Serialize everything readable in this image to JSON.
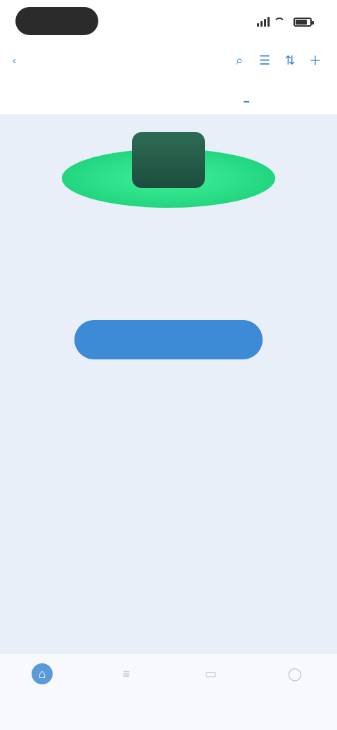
{
  "status_bar": {
    "time": "",
    "battery": ""
  },
  "header": {
    "back_label": "",
    "title": ""
  },
  "tabs": [
    {
      "label": ""
    },
    {
      "label": ""
    },
    {
      "label": ""
    },
    {
      "label": ""
    },
    {
      "label": ""
    }
  ],
  "empty_state": {
    "title": "",
    "description": "",
    "link": "",
    "button_label": ""
  },
  "bottom_nav": [
    {
      "label": "",
      "icon": "home-icon"
    },
    {
      "label": "",
      "icon": "list-icon"
    },
    {
      "label": "",
      "icon": "chat-icon"
    },
    {
      "label": "",
      "icon": "profile-icon"
    }
  ],
  "colors": {
    "accent": "#3d8ad6",
    "illustration_green": "#22d67f",
    "illustration_dark": "#1c4d3c",
    "background": "#e9eff8"
  }
}
